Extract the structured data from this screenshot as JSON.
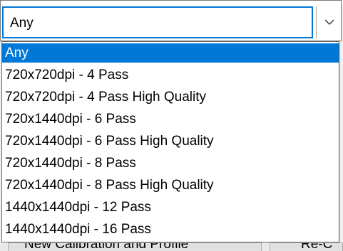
{
  "combo": {
    "value": "Any",
    "arrow_icon": "chevron-down-icon"
  },
  "dropdown": {
    "options": [
      {
        "label": "Any",
        "selected": true
      },
      {
        "label": "720x720dpi - 4 Pass",
        "selected": false
      },
      {
        "label": "720x720dpi - 4 Pass High Quality",
        "selected": false
      },
      {
        "label": "720x1440dpi - 6 Pass",
        "selected": false
      },
      {
        "label": "720x1440dpi - 6 Pass High Quality",
        "selected": false
      },
      {
        "label": "720x1440dpi - 8 Pass",
        "selected": false
      },
      {
        "label": "720x1440dpi - 8 Pass High Quality",
        "selected": false
      },
      {
        "label": "1440x1440dpi - 12 Pass",
        "selected": false
      },
      {
        "label": "1440x1440dpi - 16 Pass",
        "selected": false
      }
    ]
  },
  "background": {
    "left_button_label": "New Calibration and Profile",
    "right_button_label": "Re-C"
  },
  "colors": {
    "accent": "#0078d7",
    "selected_text": "#ffffff"
  }
}
